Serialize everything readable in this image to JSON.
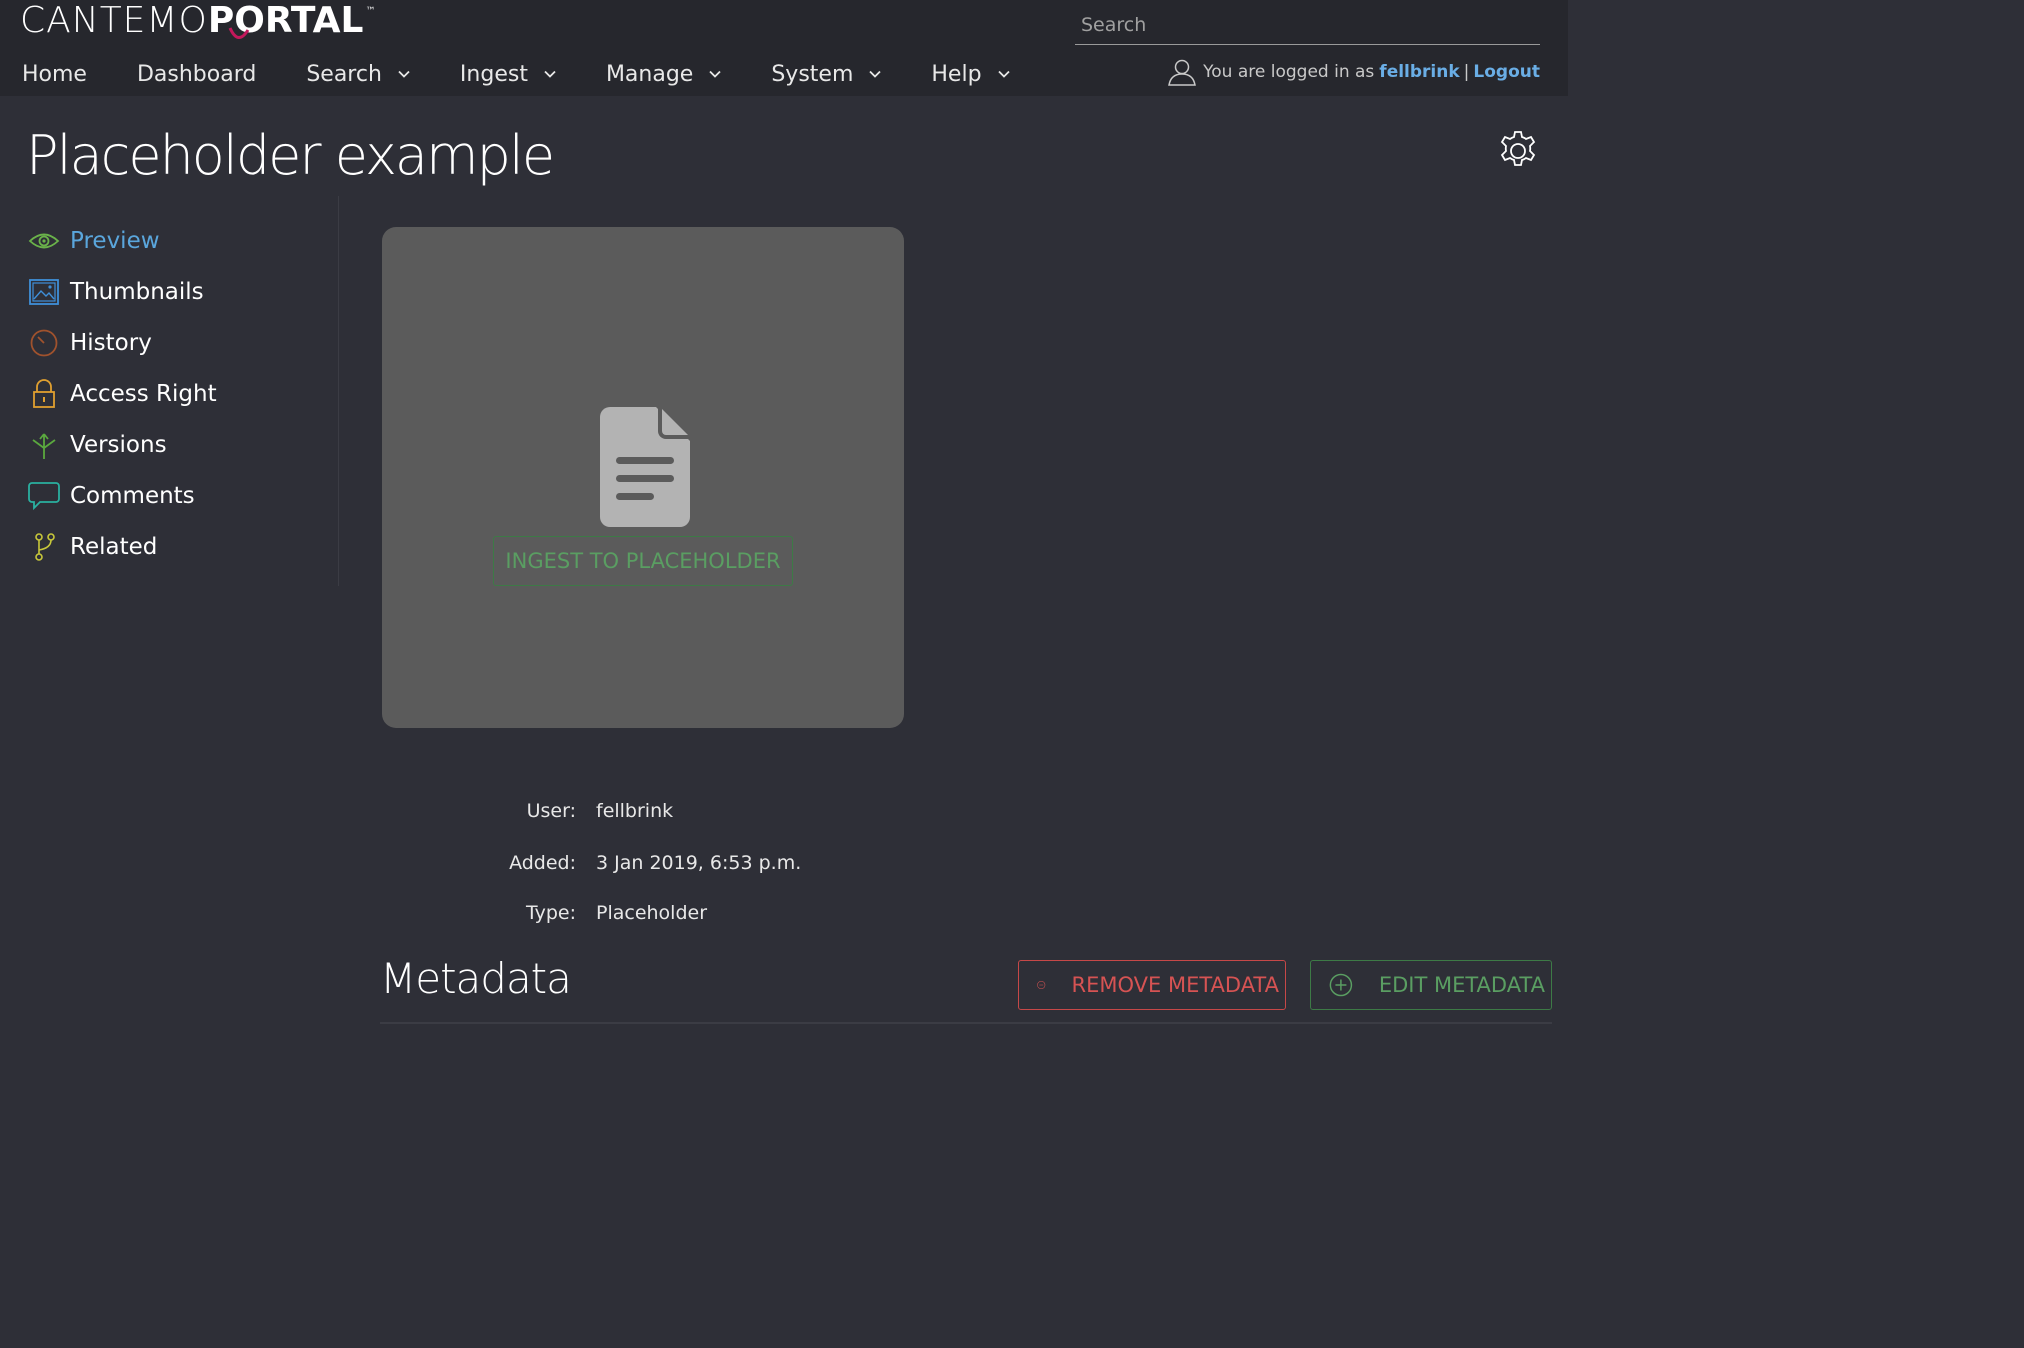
{
  "brand": {
    "logo_left": "CANTEMO",
    "logo_right": "PORTAL",
    "logo_tm": "™"
  },
  "search": {
    "placeholder": "Search"
  },
  "nav": {
    "items": [
      {
        "label": "Home",
        "has_dropdown": false
      },
      {
        "label": "Dashboard",
        "has_dropdown": false
      },
      {
        "label": "Search",
        "has_dropdown": true
      },
      {
        "label": "Ingest",
        "has_dropdown": true
      },
      {
        "label": "Manage",
        "has_dropdown": true
      },
      {
        "label": "System",
        "has_dropdown": true
      },
      {
        "label": "Help",
        "has_dropdown": true
      }
    ]
  },
  "user": {
    "logged_in_text": "You are logged in as",
    "username": "fellbrink",
    "separator": "|",
    "logout_label": "Logout"
  },
  "page": {
    "title": "Placeholder example"
  },
  "sidebar": {
    "items": [
      {
        "label": "Preview",
        "icon": "eye-icon",
        "active": true
      },
      {
        "label": "Thumbnails",
        "icon": "image-icon",
        "active": false
      },
      {
        "label": "History",
        "icon": "clock-icon",
        "active": false
      },
      {
        "label": "Access Right",
        "icon": "lock-icon",
        "active": false
      },
      {
        "label": "Versions",
        "icon": "versions-icon",
        "active": false
      },
      {
        "label": "Comments",
        "icon": "comment-icon",
        "active": false
      },
      {
        "label": "Related",
        "icon": "branch-icon",
        "active": false
      }
    ]
  },
  "preview": {
    "ingest_label": "INGEST TO PLACEHOLDER"
  },
  "info": {
    "user_label": "User:",
    "user_value": "fellbrink",
    "added_label": "Added:",
    "added_value": "3 Jan 2019, 6:53 p.m.",
    "type_label": "Type:",
    "type_value": "Placeholder"
  },
  "metadata": {
    "title": "Metadata",
    "remove_label": "REMOVE METADATA",
    "edit_label": "EDIT METADATA"
  },
  "colors": {
    "background": "#2e2f37",
    "topbar": "#26272d",
    "link_blue": "#6aaee6",
    "active_blue": "#5aa6dc",
    "green": "#5a9e62",
    "red": "#d65353",
    "preview_bg": "#5b5b5b"
  }
}
